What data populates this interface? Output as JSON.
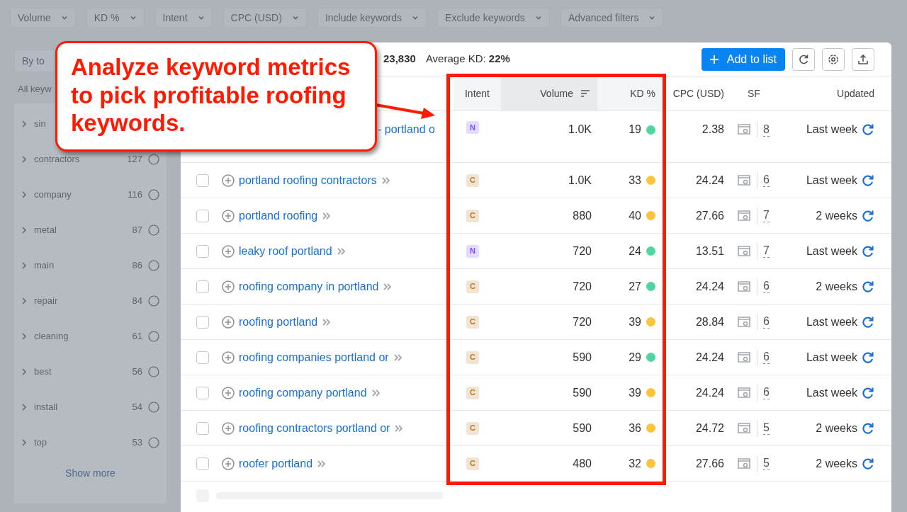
{
  "filters": [
    "Volume",
    "KD %",
    "Intent",
    "CPC (USD)",
    "Include keywords",
    "Exclude keywords",
    "Advanced filters"
  ],
  "sidebar": {
    "group_button": "By to",
    "heading": "All keyw",
    "items": [
      {
        "name": "sin"
      },
      {
        "name": "contractors",
        "count": "127"
      },
      {
        "name": "company",
        "count": "116"
      },
      {
        "name": "metal",
        "count": "87"
      },
      {
        "name": "main",
        "count": "86"
      },
      {
        "name": "repair",
        "count": "84"
      },
      {
        "name": "cleaning",
        "count": "61"
      },
      {
        "name": "best",
        "count": "56"
      },
      {
        "name": "install",
        "count": "54"
      },
      {
        "name": "top",
        "count": "53"
      }
    ],
    "show_more": "Show more"
  },
  "summary": {
    "total": "23,830",
    "kd_label": "Average KD:",
    "kd_value": "22%"
  },
  "toolbar": {
    "add_button": "Add to list"
  },
  "table": {
    "columns": [
      "Intent",
      "Volume",
      "KD %",
      "CPC (USD)",
      "SF",
      "Updated"
    ],
    "rows": [
      {
        "kind": "covered",
        "keyword": "- portland o",
        "intent": {
          "label": "N",
          "color": "#7c4dff"
        },
        "volume": "1.0K",
        "kd": {
          "value": "19",
          "color": "#4fd6a0"
        },
        "cpc": "2.38",
        "sf": "8",
        "updated": "Last week"
      },
      {
        "kind": "keyword",
        "checked": false,
        "keyword": "portland roofing contractors",
        "intent": {
          "label": "C",
          "color": "#b7791f"
        },
        "volume": "1.0K",
        "kd": {
          "value": "33",
          "color": "#fbc43b"
        },
        "cpc": "24.24",
        "sf": "6",
        "updated": "Last week"
      },
      {
        "kind": "keyword",
        "checked": false,
        "keyword": "portland roofing",
        "intent": {
          "label": "C",
          "color": "#b7791f"
        },
        "volume": "880",
        "kd": {
          "value": "40",
          "color": "#fbc43b"
        },
        "cpc": "27.66",
        "sf": "7",
        "updated": "2 weeks"
      },
      {
        "kind": "keyword",
        "checked": false,
        "keyword": "leaky roof portland",
        "intent": {
          "label": "N",
          "color": "#7c4dff"
        },
        "volume": "720",
        "kd": {
          "value": "24",
          "color": "#4fd6a0"
        },
        "cpc": "13.51",
        "sf": "7",
        "updated": "Last week"
      },
      {
        "kind": "keyword",
        "checked": false,
        "keyword": "roofing company in portland",
        "intent": {
          "label": "C",
          "color": "#b7791f"
        },
        "volume": "720",
        "kd": {
          "value": "27",
          "color": "#4fd6a0"
        },
        "cpc": "24.24",
        "sf": "6",
        "updated": "2 weeks"
      },
      {
        "kind": "keyword",
        "checked": false,
        "keyword": "roofing portland",
        "intent": {
          "label": "C",
          "color": "#b7791f"
        },
        "volume": "720",
        "kd": {
          "value": "39",
          "color": "#fbc43b"
        },
        "cpc": "28.84",
        "sf": "6",
        "updated": "Last week"
      },
      {
        "kind": "keyword",
        "checked": false,
        "keyword": "roofing companies portland or",
        "intent": {
          "label": "C",
          "color": "#b7791f"
        },
        "volume": "590",
        "kd": {
          "value": "29",
          "color": "#4fd6a0"
        },
        "cpc": "24.24",
        "sf": "6",
        "updated": "Last week"
      },
      {
        "kind": "keyword",
        "checked": false,
        "keyword": "roofing company portland",
        "intent": {
          "label": "C",
          "color": "#b7791f"
        },
        "volume": "590",
        "kd": {
          "value": "39",
          "color": "#fbc43b"
        },
        "cpc": "24.24",
        "sf": "6",
        "updated": "Last week"
      },
      {
        "kind": "keyword",
        "checked": false,
        "keyword": "roofing contractors portland or",
        "intent": {
          "label": "C",
          "color": "#b7791f"
        },
        "volume": "590",
        "kd": {
          "value": "36",
          "color": "#fbc43b"
        },
        "cpc": "24.72",
        "sf": "5",
        "updated": "2 weeks"
      },
      {
        "kind": "keyword",
        "checked": false,
        "keyword": "roofer portland",
        "intent": {
          "label": "C",
          "color": "#b7791f"
        },
        "volume": "480",
        "kd": {
          "value": "32",
          "color": "#fbc43b"
        },
        "cpc": "27.66",
        "sf": "5",
        "updated": "2 weeks"
      }
    ]
  },
  "annotation": {
    "text": "Analyze keyword metrics to pick profitable roofing keywords."
  }
}
